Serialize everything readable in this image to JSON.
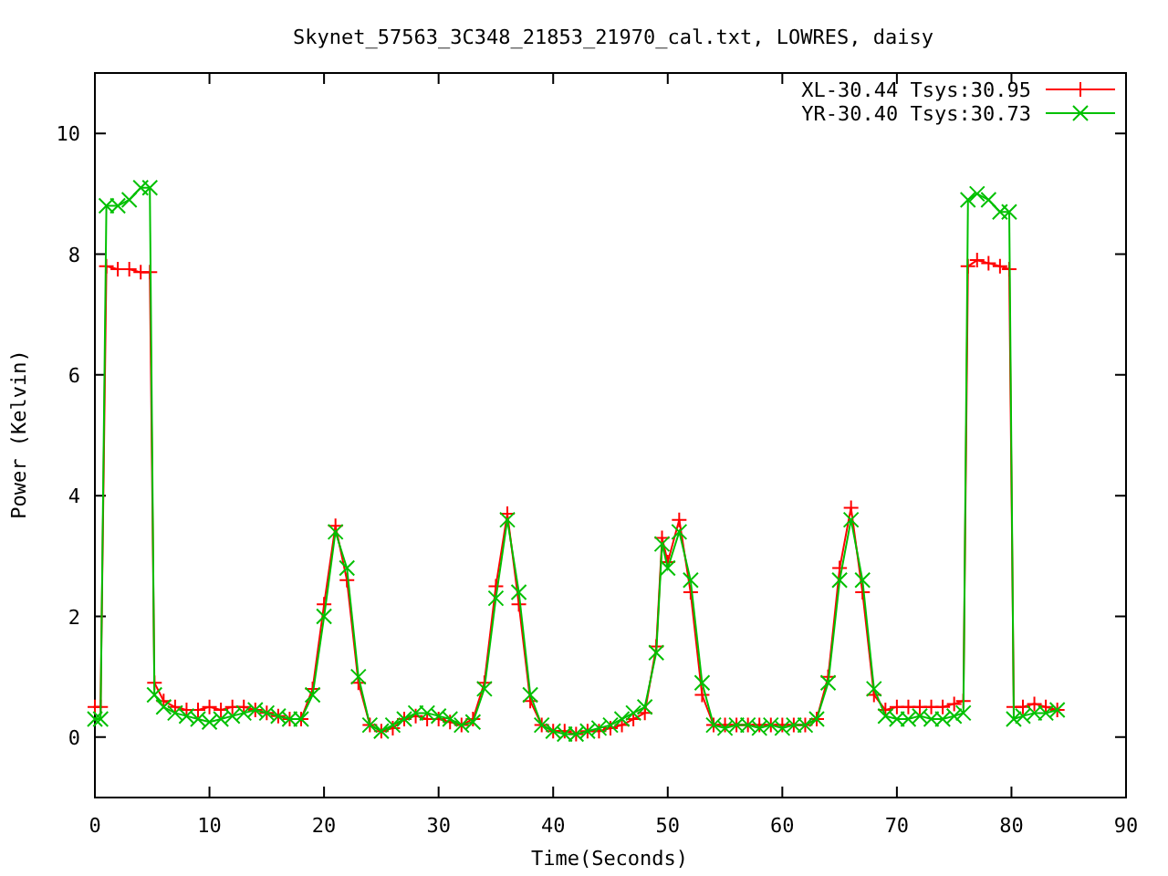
{
  "chart": {
    "chart_data": {
      "type": "line",
      "title": "Skynet_57563_3C348_21853_21970_cal.txt, LOWRES, daisy",
      "xlabel": "Time(Seconds)",
      "ylabel": "Power (Kelvin)",
      "x": [
        0,
        0.5,
        1,
        2,
        3,
        4,
        4.8,
        5.2,
        6,
        7,
        8,
        9,
        10,
        11,
        12,
        13,
        14,
        15,
        16,
        17,
        18,
        19,
        20,
        21,
        22,
        23,
        24,
        25,
        26,
        27,
        28,
        29,
        30,
        31,
        32,
        33,
        34,
        35,
        36,
        37,
        38,
        39,
        40,
        41,
        42,
        43,
        44,
        45,
        46,
        47,
        48,
        49,
        49.5,
        50,
        51,
        52,
        53,
        54,
        55,
        56,
        57,
        58,
        59,
        60,
        61,
        62,
        63,
        64,
        65,
        66,
        67,
        68,
        69,
        70,
        71,
        72,
        73,
        74,
        75,
        75.8,
        76.2,
        77,
        78,
        79,
        79.8,
        80.2,
        81,
        82,
        83,
        84
      ],
      "series": [
        {
          "name": "XL-30.44 Tsys:30.95",
          "color": "#ff0000",
          "marker": "plus",
          "values": [
            0.5,
            0.5,
            7.8,
            7.75,
            7.75,
            7.7,
            7.7,
            0.9,
            0.6,
            0.5,
            0.45,
            0.45,
            0.5,
            0.45,
            0.5,
            0.5,
            0.45,
            0.4,
            0.35,
            0.3,
            0.3,
            0.8,
            2.2,
            3.5,
            2.6,
            0.9,
            0.2,
            0.1,
            0.15,
            0.3,
            0.35,
            0.3,
            0.3,
            0.25,
            0.2,
            0.3,
            0.9,
            2.5,
            3.7,
            2.2,
            0.6,
            0.2,
            0.1,
            0.1,
            0.05,
            0.1,
            0.1,
            0.15,
            0.2,
            0.3,
            0.4,
            1.5,
            3.3,
            2.9,
            3.6,
            2.4,
            0.7,
            0.2,
            0.2,
            0.2,
            0.2,
            0.2,
            0.2,
            0.2,
            0.2,
            0.2,
            0.3,
            1.0,
            2.8,
            3.8,
            2.4,
            0.7,
            0.45,
            0.5,
            0.5,
            0.5,
            0.5,
            0.5,
            0.55,
            0.6,
            7.8,
            7.9,
            7.85,
            7.8,
            7.75,
            0.5,
            0.5,
            0.55,
            0.5,
            0.45
          ]
        },
        {
          "name": "YR-30.40 Tsys:30.73",
          "color": "#00c000",
          "marker": "cross",
          "values": [
            0.3,
            0.3,
            8.8,
            8.8,
            8.9,
            9.1,
            9.1,
            0.7,
            0.5,
            0.4,
            0.35,
            0.3,
            0.25,
            0.3,
            0.35,
            0.4,
            0.45,
            0.4,
            0.35,
            0.3,
            0.3,
            0.7,
            2.0,
            3.4,
            2.8,
            1.0,
            0.2,
            0.1,
            0.2,
            0.3,
            0.4,
            0.4,
            0.35,
            0.3,
            0.2,
            0.25,
            0.8,
            2.3,
            3.6,
            2.4,
            0.7,
            0.2,
            0.1,
            0.05,
            0.05,
            0.1,
            0.15,
            0.2,
            0.3,
            0.4,
            0.5,
            1.4,
            3.2,
            2.8,
            3.4,
            2.6,
            0.9,
            0.2,
            0.15,
            0.2,
            0.2,
            0.15,
            0.2,
            0.15,
            0.2,
            0.2,
            0.3,
            0.9,
            2.6,
            3.6,
            2.6,
            0.8,
            0.35,
            0.3,
            0.3,
            0.35,
            0.3,
            0.3,
            0.35,
            0.4,
            8.9,
            9.0,
            8.9,
            8.7,
            8.7,
            0.3,
            0.35,
            0.4,
            0.4,
            0.45
          ]
        }
      ],
      "legend": true,
      "xlim": [
        0,
        90
      ],
      "ylim": [
        -1,
        11
      ],
      "xticks": [
        0,
        10,
        20,
        30,
        40,
        50,
        60,
        70,
        80,
        90
      ],
      "yticks": [
        0,
        2,
        4,
        6,
        8,
        10
      ]
    }
  }
}
